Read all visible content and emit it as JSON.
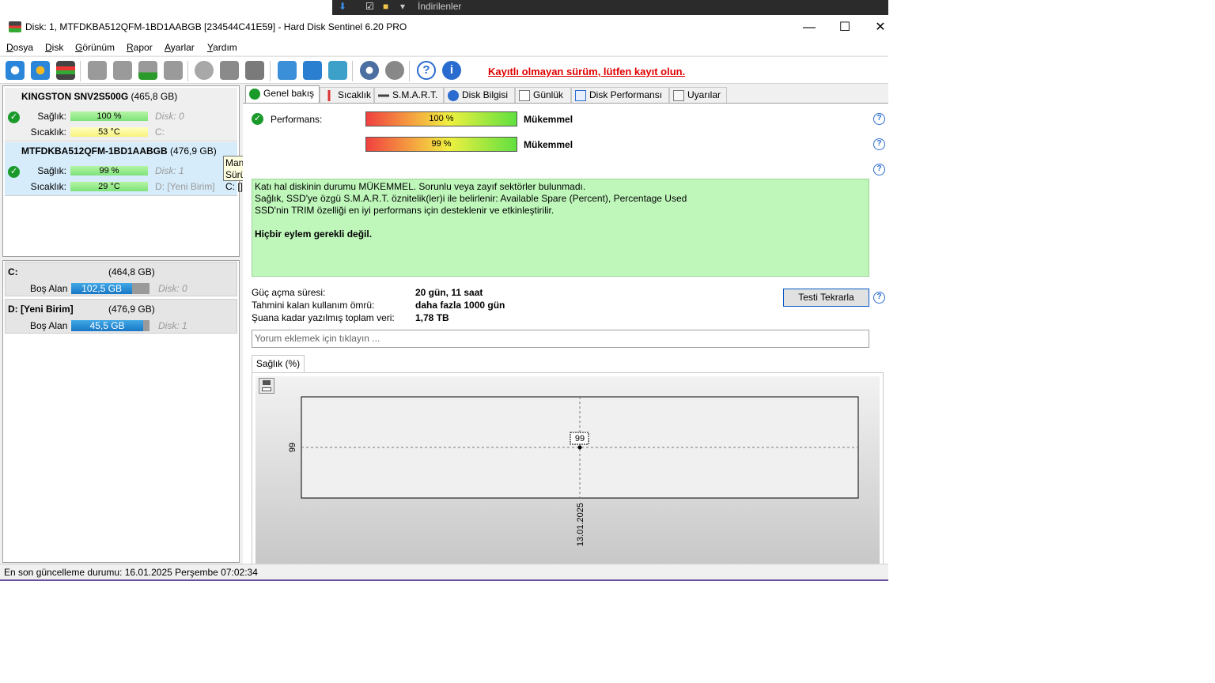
{
  "background_window": {
    "title": "İndirilenler"
  },
  "window": {
    "title": "Disk: 1, MTFDKBA512QFM-1BD1AABGB [234544C41E59]  -  Hard Disk Sentinel 6.20 PRO",
    "minimize": "—",
    "maximize": "☐",
    "close": "✕"
  },
  "menu": [
    {
      "pre": "",
      "u": "D",
      "post": "osya"
    },
    {
      "pre": "",
      "u": "D",
      "post": "isk"
    },
    {
      "pre": "",
      "u": "G",
      "post": "örünüm"
    },
    {
      "pre": "",
      "u": "R",
      "post": "apor"
    },
    {
      "pre": "",
      "u": "A",
      "post": "yarlar"
    },
    {
      "pre": "",
      "u": "Y",
      "post": "ardım"
    }
  ],
  "toolbar": {
    "unregistered": "Kayıtlı olmayan sürüm, lütfen kayıt olun."
  },
  "disks": [
    {
      "model": "KINGSTON SNV2S500G",
      "size": "(465,8 GB)",
      "health_label": "Sağlık:",
      "health": "100 %",
      "health_info": "Disk: 0",
      "temp_label": "Sıcaklık:",
      "temp": "53 °C",
      "temp_info": "C:"
    },
    {
      "model": "MTFDKBA512QFM-1BD1AABGB",
      "size": "(476,9 GB)",
      "health_label": "Sağlık:",
      "health": "99 %",
      "health_info": "Disk: 1",
      "temp_label": "Sıcaklık:",
      "temp": "29 °C",
      "temp_info": "D: [Yeni Birim]"
    }
  ],
  "tooltip": {
    "line1": "Mantıksal Sürücü(ler)",
    "line2": "C: [] NTFS"
  },
  "volumes": [
    {
      "name": "C:",
      "size": "(464,8 GB)",
      "free_label": "Boş Alan",
      "free": "102,5 GB",
      "free_fraction": 0.78,
      "disk": "Disk: 0"
    },
    {
      "name": "D: [Yeni Birim]",
      "size": "(476,9 GB)",
      "free_label": "Boş Alan",
      "free": "45,5 GB",
      "free_fraction": 0.92,
      "disk": "Disk: 1"
    }
  ],
  "tabs": [
    {
      "label": "Genel bakış",
      "icon": "check-icon",
      "active": true
    },
    {
      "label": "Sıcaklık",
      "icon": "thermometer-icon"
    },
    {
      "label": "S.M.A.R.T.",
      "icon": "disk-icon"
    },
    {
      "label": "Disk Bilgisi",
      "icon": "info-icon"
    },
    {
      "label": "Günlük",
      "icon": "document-icon"
    },
    {
      "label": "Disk Performansı",
      "icon": "chart-icon"
    },
    {
      "label": "Uyarılar",
      "icon": "alerts-icon"
    }
  ],
  "overview": {
    "performance_label": "Performans:",
    "performance_value": "100 %",
    "performance_word": "Mükemmel",
    "health_value": "99 %",
    "health_word": "Mükemmel",
    "status_lines": [
      "Katı hal diskinin durumu MÜKEMMEL. Sorunlu veya zayıf sektörler bulunmadı.",
      "Sağlık, SSD'ye özgü S.M.A.R.T. öznitelik(ler)i ile belirlenir:  Available Spare (Percent), Percentage Used",
      "SSD'nin TRIM özelliği en iyi performans için desteklenir ve etkinleştirilir.",
      "",
      "Hiçbir eylem gerekli değil."
    ],
    "power_on_label": "Güç açma süresi:",
    "power_on_value": "20 gün, 11 saat",
    "lifetime_label": "Tahmini kalan kullanım ömrü:",
    "lifetime_value": "daha fazla 1000 gün",
    "written_label": "Şuana kadar yazılmış toplam veri:",
    "written_value": "1,78 TB",
    "retest_button": "Testi Tekrarla",
    "comment_placeholder": "Yorum eklemek için tıklayın ..."
  },
  "chart_tab": "Sağlık (%)",
  "chart_data": {
    "type": "line",
    "title": "",
    "xlabel": "",
    "ylabel": "",
    "x": [
      "13.01.2025"
    ],
    "series": [
      {
        "values": [
          99
        ]
      }
    ],
    "y_ticks": [
      "99"
    ],
    "data_labels": [
      "99"
    ],
    "grid": true
  },
  "statusbar": {
    "text": "En son güncelleme durumu: 16.01.2025 Perşembe 07:02:34"
  }
}
